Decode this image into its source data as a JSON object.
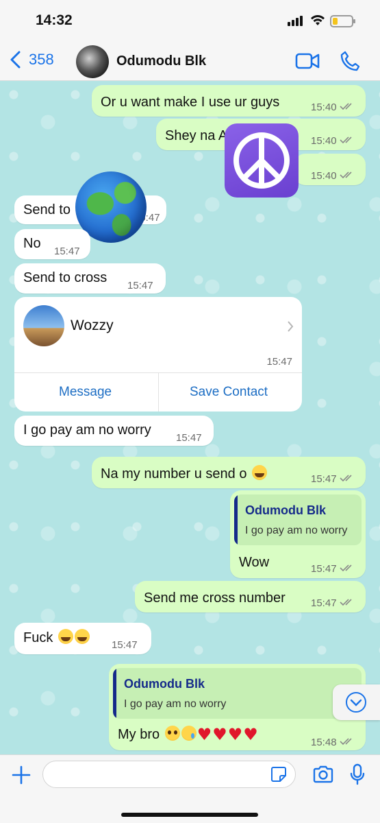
{
  "status": {
    "time": "14:32",
    "battery_level": 0.25,
    "battery_color": "#f4c41c"
  },
  "header": {
    "back_count": "358",
    "contact_name": "Odumodu Blk"
  },
  "messages": {
    "m1": {
      "text": "Or u want make I use ur guys",
      "time": "15:40"
    },
    "m2": {
      "text": "Shey na A",
      "time": "15:40"
    },
    "m3": {
      "time": "15:40"
    },
    "m4": {
      "text": "Send to",
      "time": "15:47"
    },
    "m5": {
      "text": "No",
      "time": "15:47"
    },
    "m6": {
      "text": "Send to cross",
      "time": "15:47"
    },
    "m7": {
      "text": "I go pay am no worry",
      "time": "15:47"
    },
    "m8": {
      "text": "Na my number u send o",
      "time": "15:47"
    },
    "m9": {
      "quote_name": "Odumodu Blk",
      "quote_text": "I go pay am no worry",
      "text": "Wow",
      "time": "15:47"
    },
    "m10": {
      "text": "Send me cross number",
      "time": "15:47"
    },
    "m11": {
      "text": "Fuck",
      "time": "15:47"
    },
    "m12": {
      "quote_name": "Odumodu Blk",
      "quote_text": "I go pay am no worry",
      "text": "My bro",
      "time": "15:48"
    }
  },
  "contact_card": {
    "name": "Wozzy",
    "time": "15:47",
    "message_label": "Message",
    "save_label": "Save Contact"
  },
  "stickers": {
    "globe": "globe-emoji",
    "peace": "peace-symbol-emoji"
  },
  "composer": {
    "placeholder": ""
  },
  "colors": {
    "outgoing": "#d9fdc4",
    "incoming": "#ffffff",
    "accent": "#1a73e8",
    "quote_bar": "#152a8a"
  }
}
